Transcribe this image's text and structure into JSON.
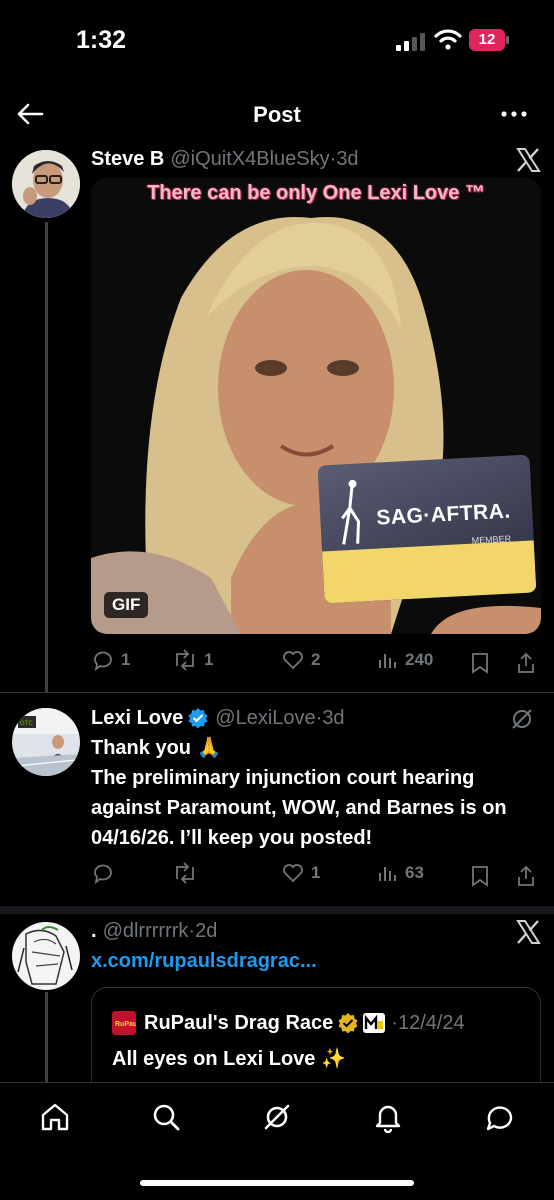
{
  "status_bar": {
    "time": "1:32",
    "battery": "12"
  },
  "header": {
    "title": "Post"
  },
  "posts": [
    {
      "name": "Steve B",
      "handle": "@iQuitX4BlueSky",
      "time": "3d",
      "media": {
        "caption": "There can be only One Lexi Love ™",
        "card_text": "SAG·AFTRA.",
        "card_member": "MEMBER",
        "badge": "GIF"
      },
      "stats": {
        "replies": "1",
        "reposts": "1",
        "likes": "2",
        "views": "240"
      }
    },
    {
      "name": "Lexi Love",
      "handle": "@LexiLove",
      "time": "3d",
      "verified": true,
      "text_line1": "Thank you 🙏",
      "text_rest": "The preliminary injunction court hearing against Paramount, WOW, and Barnes is on 04/16/26. I’ll keep you posted!",
      "stats": {
        "replies": "",
        "reposts": "",
        "likes": "1",
        "views": "63"
      }
    },
    {
      "name": ".",
      "handle": "@dlrrrrrrk",
      "time": "2d",
      "link": "x.com/rupaulsdragrac...",
      "quote": {
        "name": "RuPaul's Drag Race",
        "time": "12/4/24",
        "text": "All eyes on Lexi Love ✨"
      }
    }
  ],
  "colors": {
    "accent": "#1d9bf0",
    "muted": "#71767b",
    "verified": "#1d9bf0",
    "battery": "#e0245e"
  },
  "icons": [
    "back-arrow-icon",
    "more-icon",
    "x-logo-icon",
    "reply-icon",
    "repost-icon",
    "like-icon",
    "views-icon",
    "bookmark-icon",
    "share-icon",
    "home-icon",
    "search-icon",
    "grok-icon",
    "notifications-icon",
    "messages-icon"
  ]
}
